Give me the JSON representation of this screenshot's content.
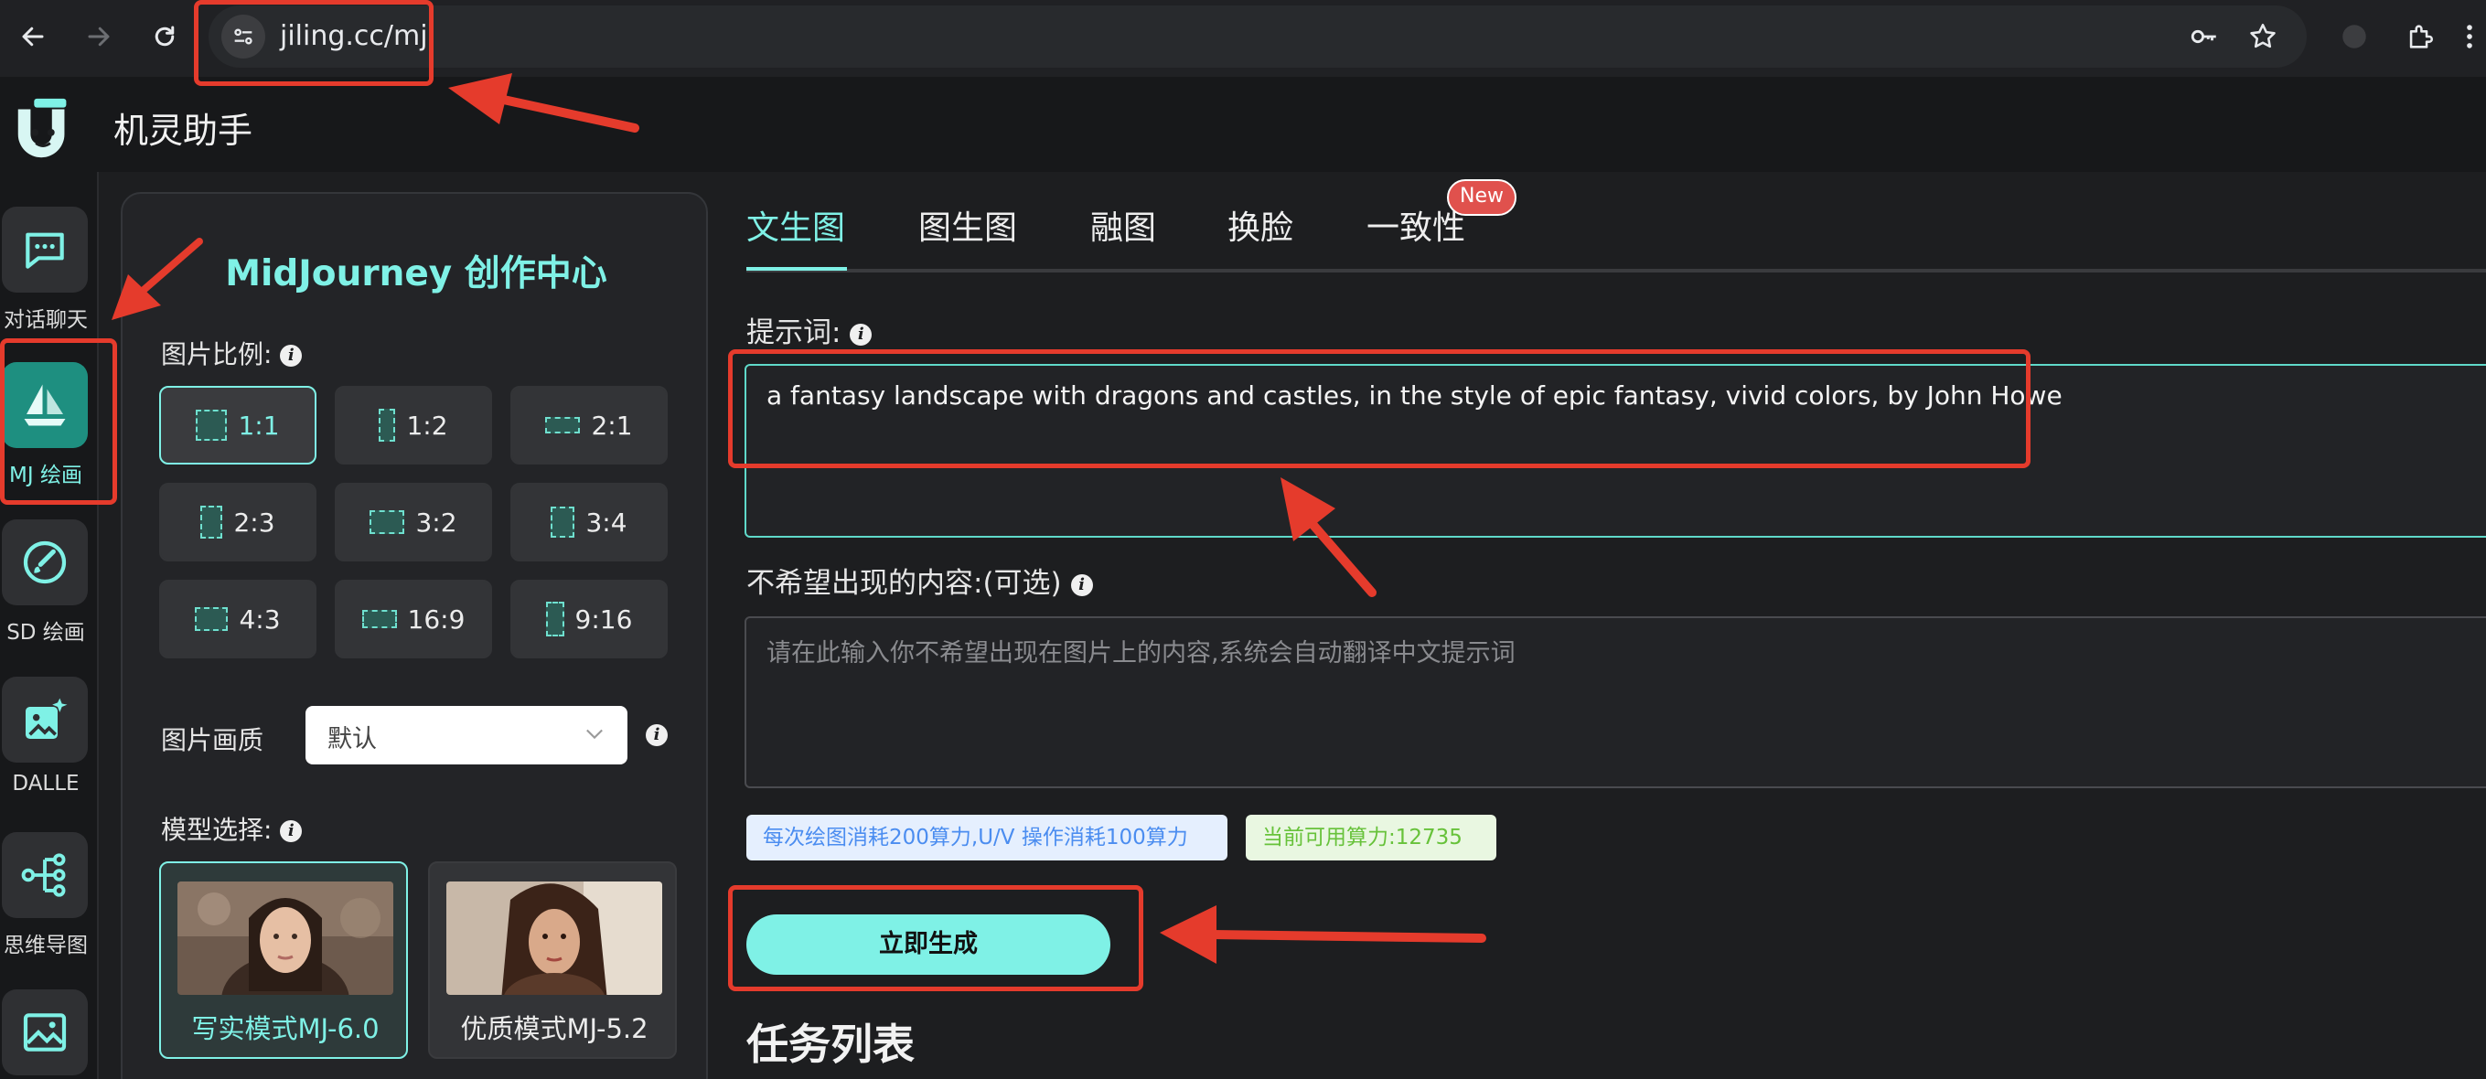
{
  "browser": {
    "url": "jiling.cc/mj"
  },
  "app": {
    "title": "机灵助手"
  },
  "rail": {
    "items": [
      {
        "label": "对话聊天",
        "icon": "chat-icon"
      },
      {
        "label": "MJ 绘画",
        "icon": "sailboat-icon",
        "active": true
      },
      {
        "label": "SD 绘画",
        "icon": "brush-icon"
      },
      {
        "label": "DALLE",
        "icon": "image-sparkle-icon"
      },
      {
        "label": "思维导图",
        "icon": "mindmap-icon"
      },
      {
        "label": "",
        "icon": "image-icon"
      }
    ]
  },
  "panel": {
    "title": "MidJourney 创作中心",
    "ratio_label": "图片比例:",
    "ratios": [
      "1:1",
      "1:2",
      "2:1",
      "2:3",
      "3:2",
      "3:4",
      "4:3",
      "16:9",
      "9:16"
    ],
    "selected_ratio": "1:1",
    "quality_label": "图片画质",
    "quality_value": "默认",
    "model_label": "模型选择:",
    "models": [
      {
        "label": "写实模式MJ-6.0",
        "selected": true
      },
      {
        "label": "优质模式MJ-5.2",
        "selected": false
      }
    ]
  },
  "tabs": [
    {
      "label": "文生图",
      "active": true
    },
    {
      "label": "图生图"
    },
    {
      "label": "融图"
    },
    {
      "label": "换脸"
    },
    {
      "label": "一致性",
      "badge": "New"
    }
  ],
  "form": {
    "prompt_label": "提示词:",
    "prompt_value": "a fantasy landscape with dragons and castles, in the style of epic fantasy, vivid colors, by John Howe",
    "negative_label": "不希望出现的内容:(可选)",
    "negative_placeholder": "请在此输入你不希望出现在图片上的内容,系统会自动翻译中文提示词",
    "cost_tag": "每次绘图消耗200算力,U/V 操作消耗100算力",
    "balance_tag": "当前可用算力:12735",
    "generate_button": "立即生成"
  },
  "tasks": {
    "title": "任务列表"
  },
  "colors": {
    "accent": "#7ff1e6",
    "annotation": "#e53b2c",
    "badge": "#e0514d"
  }
}
